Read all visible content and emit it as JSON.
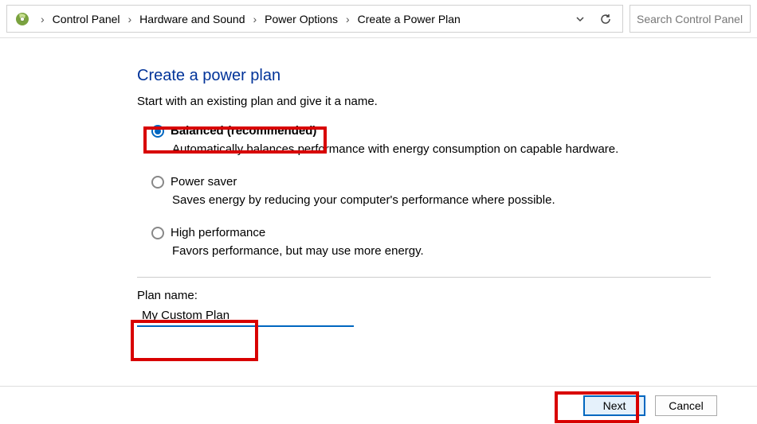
{
  "breadcrumb": {
    "items": [
      "Control Panel",
      "Hardware and Sound",
      "Power Options",
      "Create a Power Plan"
    ]
  },
  "search": {
    "placeholder": "Search Control Panel"
  },
  "page": {
    "title": "Create a power plan",
    "subtitle": "Start with an existing plan and give it a name."
  },
  "plans": [
    {
      "label": "Balanced (recommended)",
      "desc": "Automatically balances performance with energy consumption on capable hardware.",
      "selected": true,
      "bold": true
    },
    {
      "label": "Power saver",
      "desc": "Saves energy by reducing your computer's performance where possible.",
      "selected": false,
      "bold": false
    },
    {
      "label": "High performance",
      "desc": "Favors performance, but may use more energy.",
      "selected": false,
      "bold": false
    }
  ],
  "plan_name": {
    "label": "Plan name:",
    "value": "My Custom Plan "
  },
  "buttons": {
    "next": "Next",
    "cancel": "Cancel"
  }
}
